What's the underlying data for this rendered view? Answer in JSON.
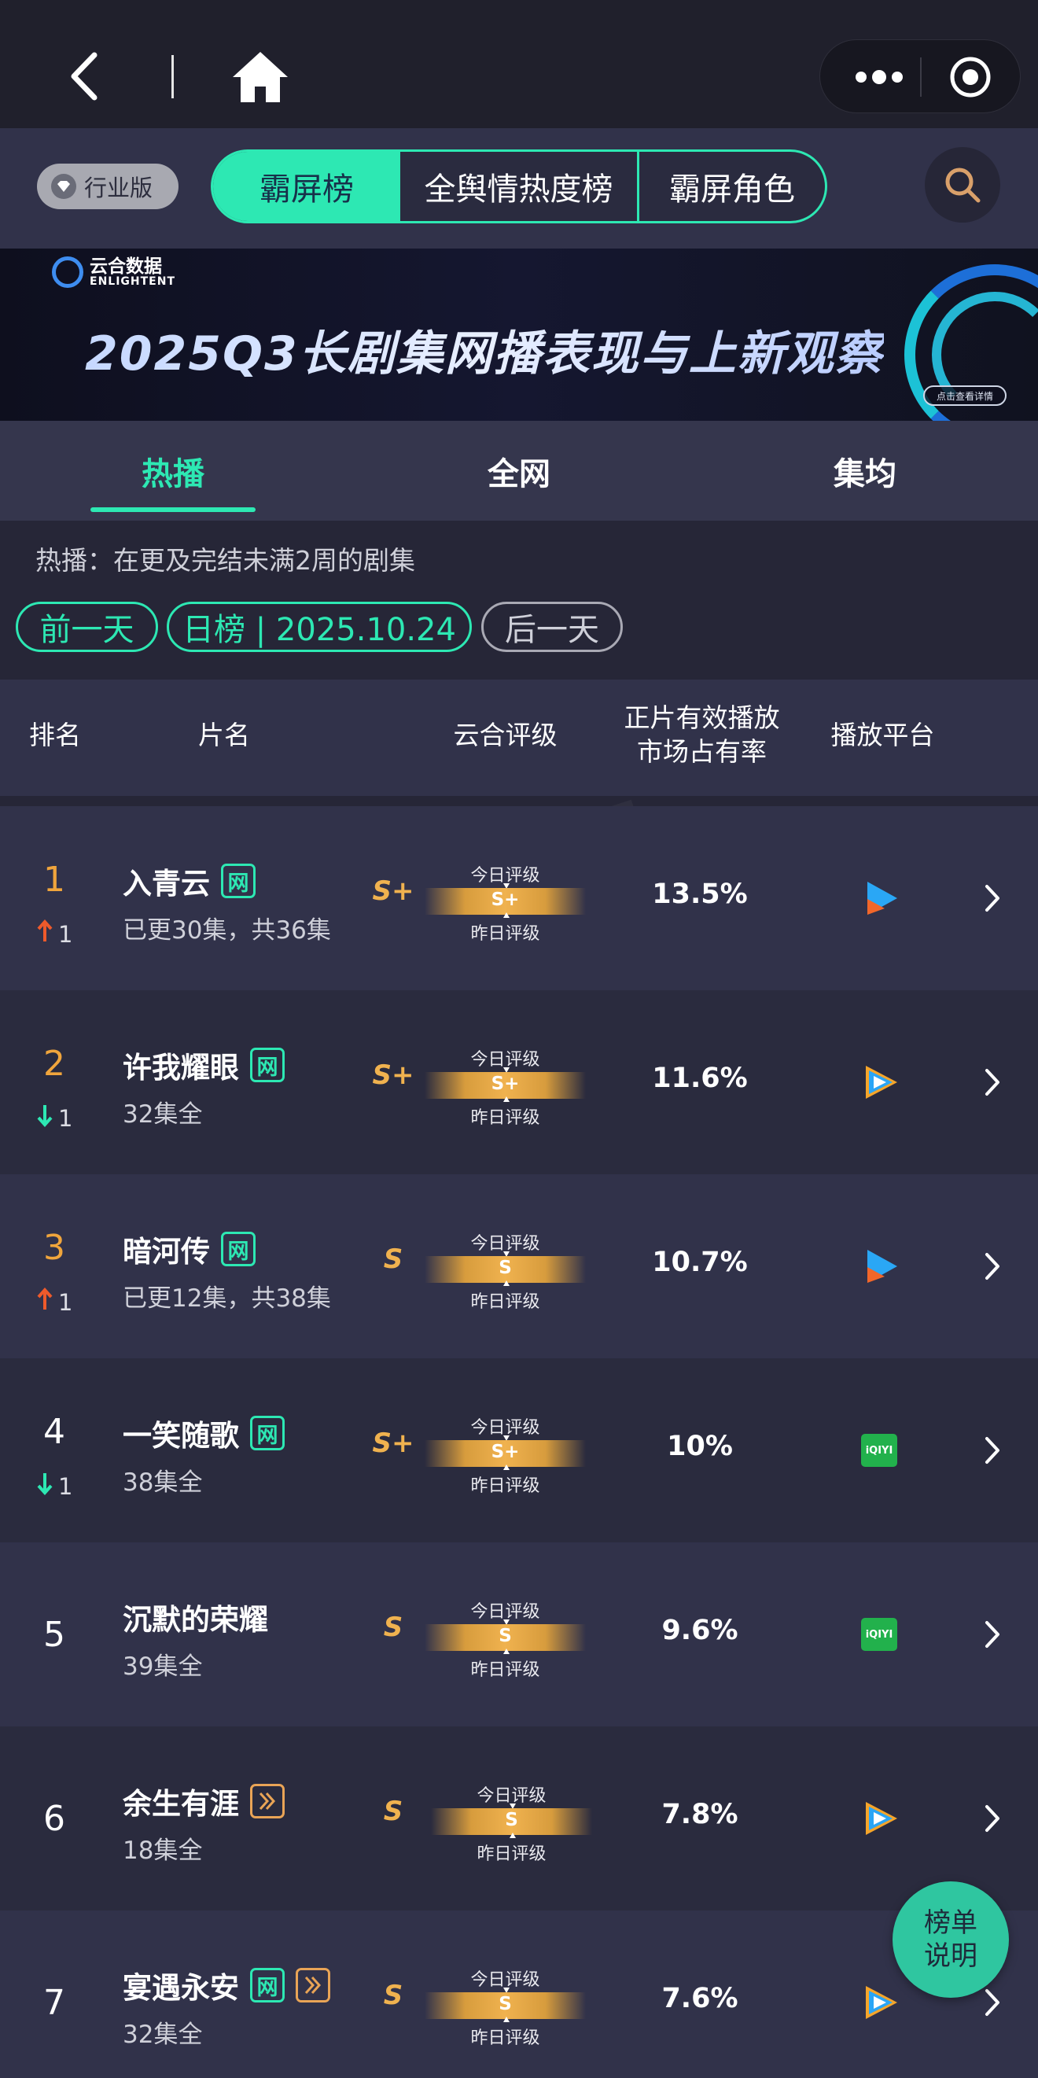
{
  "top_nav": {
    "back_icon": "chevron-left-icon",
    "home_icon": "home-icon",
    "more_icon": "more-dots-icon",
    "close_icon": "target-icon"
  },
  "tab_bar": {
    "industry_label": "行业版",
    "tabs": [
      "霸屏榜",
      "全舆情热度榜",
      "霸屏角色"
    ],
    "active_tab": "霸屏榜",
    "accent_color": "#2de8b3"
  },
  "banner": {
    "brand_cn": "云合数据",
    "brand_en": "ENLIGHTENT",
    "title": "2025Q3长剧集网播表现与上新观察",
    "cta": "点击查看详情"
  },
  "sub_tabs": {
    "items": [
      "热播",
      "全网",
      "集均"
    ],
    "active": "热播"
  },
  "filter": {
    "description": "热播：在更及完结未满2周的剧集",
    "prev_label": "前一天",
    "date_label": "日榜 | 2025.10.24",
    "next_label": "后一天"
  },
  "table_header": {
    "rank": "排名",
    "title": "片名",
    "rating": "云合评级",
    "share_line1": "正片有效播放",
    "share_line2": "市场占有率",
    "platform": "播放平台"
  },
  "meter_labels": {
    "today": "今日评级",
    "yesterday": "昨日评级"
  },
  "rows": [
    {
      "rank": "1",
      "trend": "1",
      "trend_dir": "up",
      "title": "入青云",
      "badges": [
        "网"
      ],
      "episodes": "已更30集，共36集",
      "grade": "S+",
      "today": "S+",
      "share": "13.5%",
      "platform": "youku"
    },
    {
      "rank": "2",
      "trend": "1",
      "trend_dir": "down",
      "title": "许我耀眼",
      "badges": [
        "网"
      ],
      "episodes": "32集全",
      "grade": "S+",
      "today": "S+",
      "share": "11.6%",
      "platform": "tencent"
    },
    {
      "rank": "3",
      "trend": "1",
      "trend_dir": "up",
      "title": "暗河传",
      "badges": [
        "网"
      ],
      "episodes": "已更12集，共38集",
      "grade": "S",
      "today": "S",
      "share": "10.7%",
      "platform": "youku"
    },
    {
      "rank": "4",
      "trend": "1",
      "trend_dir": "down",
      "title": "一笑随歌",
      "badges": [
        "网"
      ],
      "episodes": "38集全",
      "grade": "S+",
      "today": "S+",
      "share": "10%",
      "platform": "iqiyi"
    },
    {
      "rank": "5",
      "trend": "",
      "trend_dir": "none",
      "title": "沉默的荣耀",
      "badges": [],
      "episodes": "39集全",
      "grade": "S",
      "today": "S",
      "share": "9.6%",
      "platform": "iqiyi"
    },
    {
      "rank": "6",
      "trend": "",
      "trend_dir": "none",
      "title": "余生有涯",
      "badges": [
        "ff"
      ],
      "episodes": "18集全",
      "grade": "S",
      "today": "S",
      "share": "7.8%",
      "platform": "tencent"
    },
    {
      "rank": "7",
      "trend": "",
      "trend_dir": "none",
      "title": "宴遇永安",
      "badges": [
        "网",
        "ff"
      ],
      "episodes": "32集全",
      "grade": "S",
      "today": "S",
      "share": "7.6%",
      "platform": "tencent"
    }
  ],
  "platform_labels": {
    "iqiyi": "iQIYI"
  },
  "fab": {
    "line1": "榜单",
    "line2": "说明"
  },
  "colors": {
    "rank_top3": "#f0a53c",
    "rank_rest": "#ffffff",
    "trend_up": "#ee5a2b",
    "trend_down": "#2de8b3",
    "grade": "#f0b24f"
  }
}
